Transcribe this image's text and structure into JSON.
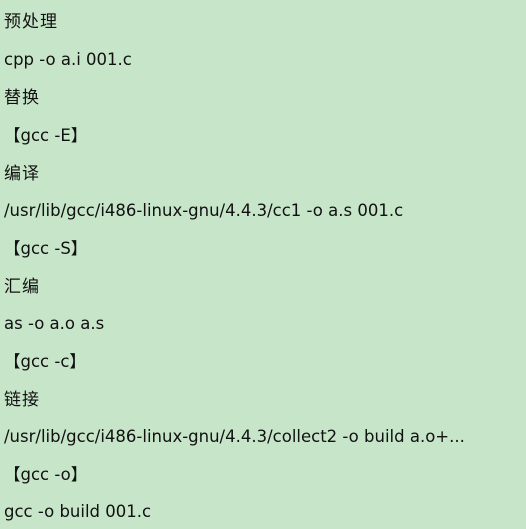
{
  "lines": [
    {
      "text": "预处理",
      "kind": "heading"
    },
    {
      "text": "cpp -o a.i 001.c",
      "kind": "command"
    },
    {
      "text": "替换",
      "kind": "heading"
    },
    {
      "text": "【gcc -E】",
      "kind": "flag"
    },
    {
      "text": "编译",
      "kind": "heading"
    },
    {
      "text": "/usr/lib/gcc/i486-linux-gnu/4.4.3/cc1 -o a.s 001.c",
      "kind": "command"
    },
    {
      "text": "【gcc -S】",
      "kind": "flag"
    },
    {
      "text": "汇编",
      "kind": "heading"
    },
    {
      "text": "as -o a.o a.s",
      "kind": "command"
    },
    {
      "text": "【gcc -c】",
      "kind": "flag"
    },
    {
      "text": "链接",
      "kind": "heading"
    },
    {
      "text": "/usr/lib/gcc/i486-linux-gnu/4.4.3/collect2 -o build a.o+...",
      "kind": "command"
    },
    {
      "text": "【gcc -o】",
      "kind": "flag"
    },
    {
      "text": "gcc -o build 001.c",
      "kind": "command"
    }
  ],
  "colors": {
    "background": "#c7e5c8",
    "text": "#111111"
  }
}
